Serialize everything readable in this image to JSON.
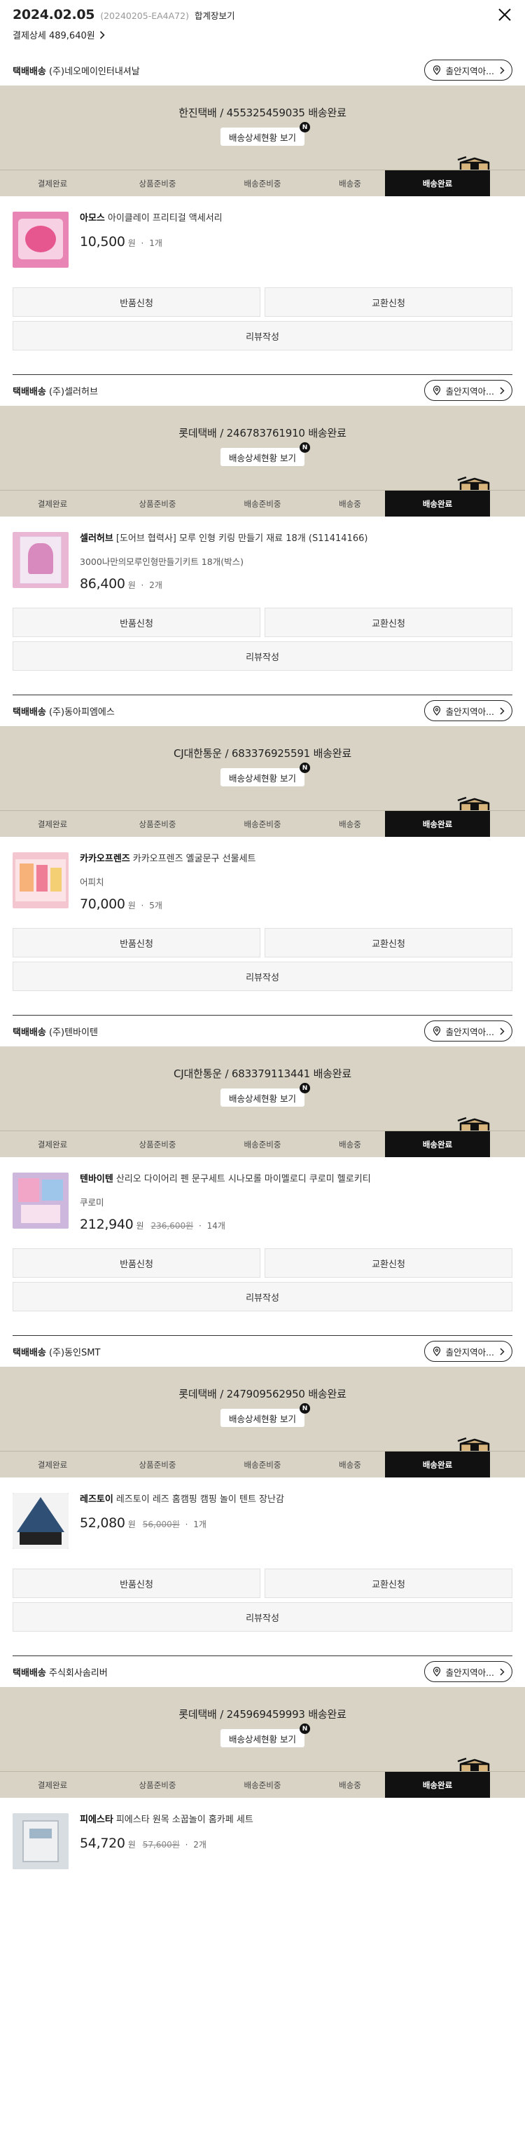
{
  "header": {
    "date": "2024.02.05",
    "order_no": "(20240205-EA4A72)",
    "combined_label": "합계장보기",
    "payment_detail": "결제상세 489,640원"
  },
  "common": {
    "view_button": "배송상세현황 보기",
    "new_badge": "N",
    "address_pill": "출안지역아...",
    "steps": [
      "결제완료",
      "상품준비중",
      "배송준비중",
      "배송중",
      "배송완료"
    ],
    "return_label": "반품신청",
    "exchange_label": "교환신청",
    "review_label": "리뷰작성",
    "won": "원",
    "colors": {
      "banner": "#d8d3c5",
      "active_step": "#111111"
    }
  },
  "orders": [
    {
      "shop_type": "택배배송",
      "shop_name": "(주)네오메이인터내셔날",
      "carrier": "한진택배 / 455325459035 배송완료",
      "brand": "아모스",
      "product": "아이클레이 프리티걸 액세서리",
      "option": "",
      "price": "10,500",
      "orig_price": "",
      "qty": "1개",
      "thumb_color": "#e985b4"
    },
    {
      "shop_type": "택배배송",
      "shop_name": "(주)셀러허브",
      "carrier": "롯데택배 / 246783761910 배송완료",
      "brand": "셀러허브",
      "product": "[도어브 협력사] 모루 인형 키링 만들기 재료 18개 (S11414166)",
      "option": "3000나만의모루인형만들기키트 18개(박스)",
      "price": "86,400",
      "orig_price": "",
      "qty": "2개",
      "thumb_color": "#e9b6d4"
    },
    {
      "shop_type": "택배배송",
      "shop_name": "(주)동아피엠에스",
      "carrier": "CJ대한통운 / 683376925591 배송완료",
      "brand": "카카오프렌즈",
      "product": "카카오프렌즈 옐굴문구 선물세트",
      "option": "어피치",
      "price": "70,000",
      "orig_price": "",
      "qty": "5개",
      "thumb_color": "#f4c6cf"
    },
    {
      "shop_type": "택배배송",
      "shop_name": "(주)텐바이텐",
      "carrier": "CJ대한통운 / 683379113441 배송완료",
      "brand": "텐바이텐",
      "product": "산리오 다이어리 펜 문구세트 시나모롤 마이멜로디 쿠로미 헬로키티",
      "option": "쿠로미",
      "price": "212,940",
      "orig_price": "236,600원",
      "qty": "14개",
      "thumb_color": "#c9b3d9"
    },
    {
      "shop_type": "택배배송",
      "shop_name": "(주)동인SMT",
      "carrier": "롯데택배 / 247909562950 배송완료",
      "brand": "레즈토이",
      "product": "레즈토이 레즈 홈캠핑 캠핑 놀이 텐트 장난감",
      "option": "",
      "price": "52,080",
      "orig_price": "56,000원",
      "qty": "1개",
      "thumb_color": "#2d4a6b"
    },
    {
      "shop_type": "택배배송",
      "shop_name": "주식회사솜리버",
      "carrier": "롯데택배 / 245969459993 배송완료",
      "brand": "피에스타",
      "product": "피에스타 원목 소꿉놀이 홈카페 세트",
      "option": "",
      "price": "54,720",
      "orig_price": "57,600원",
      "qty": "2개",
      "thumb_color": "#c9cdd2"
    }
  ]
}
